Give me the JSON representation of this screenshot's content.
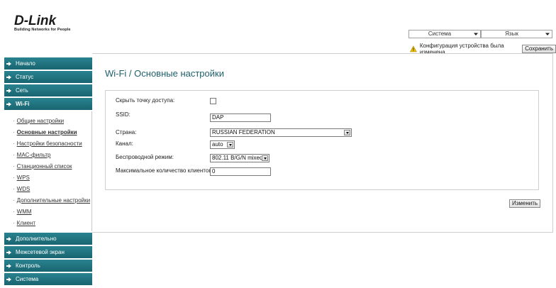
{
  "logo": {
    "brand": "D-Link",
    "tagline": "Building Networks for People"
  },
  "header": {
    "system_select": "Система",
    "language_select": "Язык",
    "notice_text": "Конфигурация устройства была изменена",
    "save_label": "Сохранить"
  },
  "sidebar": {
    "items": [
      {
        "label": "Начало"
      },
      {
        "label": "Статус"
      },
      {
        "label": "Сеть"
      },
      {
        "label": "Wi-Fi"
      }
    ],
    "wifi_sub": [
      {
        "label": "Общие настройки"
      },
      {
        "label": "Основные настройки"
      },
      {
        "label": "Настройки безопасности"
      },
      {
        "label": "MAC-фильтр"
      },
      {
        "label": "Станционный список"
      },
      {
        "label": "WPS"
      },
      {
        "label": "WDS"
      },
      {
        "label": "Дополнительные настройки"
      },
      {
        "label": "WMM"
      },
      {
        "label": "Клиент"
      }
    ],
    "items_after": [
      {
        "label": "Дополнительно"
      },
      {
        "label": "Межсетевой экран"
      },
      {
        "label": "Контроль"
      },
      {
        "label": "Система"
      }
    ]
  },
  "main": {
    "title": "Wi-Fi /  Основные настройки",
    "form": {
      "hide_ap_label": "Скрыть точку доступа:",
      "ssid_label": "SSID:",
      "ssid_value": "DAP",
      "country_label": "Страна:",
      "country_value": "RUSSIAN FEDERATION",
      "channel_label": "Канал:",
      "channel_value": "auto",
      "mode_label": "Беспроводной режим:",
      "mode_value": "802.11 B/G/N mixed",
      "max_clients_label": "Максимальное количество клиентов:",
      "max_clients_value": "0"
    },
    "change_label": "Изменить"
  }
}
